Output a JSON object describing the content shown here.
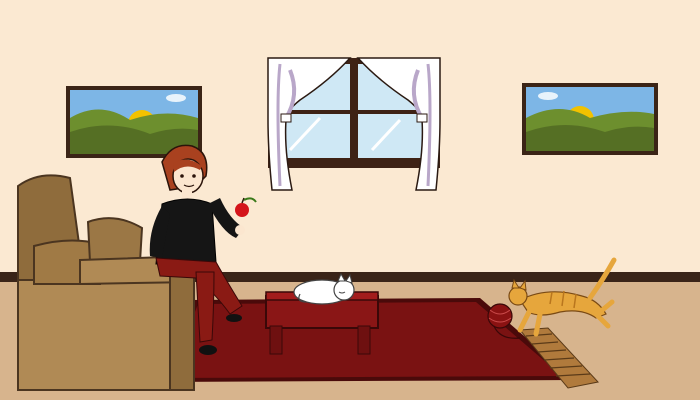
{
  "scene": {
    "colors": {
      "wall": "#fbe9d2",
      "baseboard": "#3a2418",
      "floor": "#d7b48d",
      "rug": "#7a1212",
      "rug_border": "#4a0a0a",
      "sofa": "#b08a55",
      "sofa_dark": "#8f6c3c",
      "ottoman": "#8a1616",
      "woman_top": "#151515",
      "woman_pants": "#8a1a14",
      "woman_hair": "#a9411f",
      "apple": "#d4141a",
      "cat_sleeping": "#ffffff",
      "cat_running": "#e6a63c",
      "yarn": "#8a1212",
      "curtain": "#ffffff",
      "curtain_shadow": "#b9a7c9",
      "window_frame": "#3e2215",
      "sky": "#cfe8f5",
      "painting_sky": "#7db6e6",
      "painting_hill": "#6d8f2e",
      "painting_sun": "#f2c200",
      "frame": "#3b2416"
    },
    "objects": [
      "painting-left",
      "window-with-curtains",
      "painting-right",
      "sofa",
      "woman-holding-apple",
      "rug",
      "ottoman",
      "sleeping-white-cat",
      "running-orange-cat",
      "yarn-ball",
      "fringe-mat"
    ]
  }
}
